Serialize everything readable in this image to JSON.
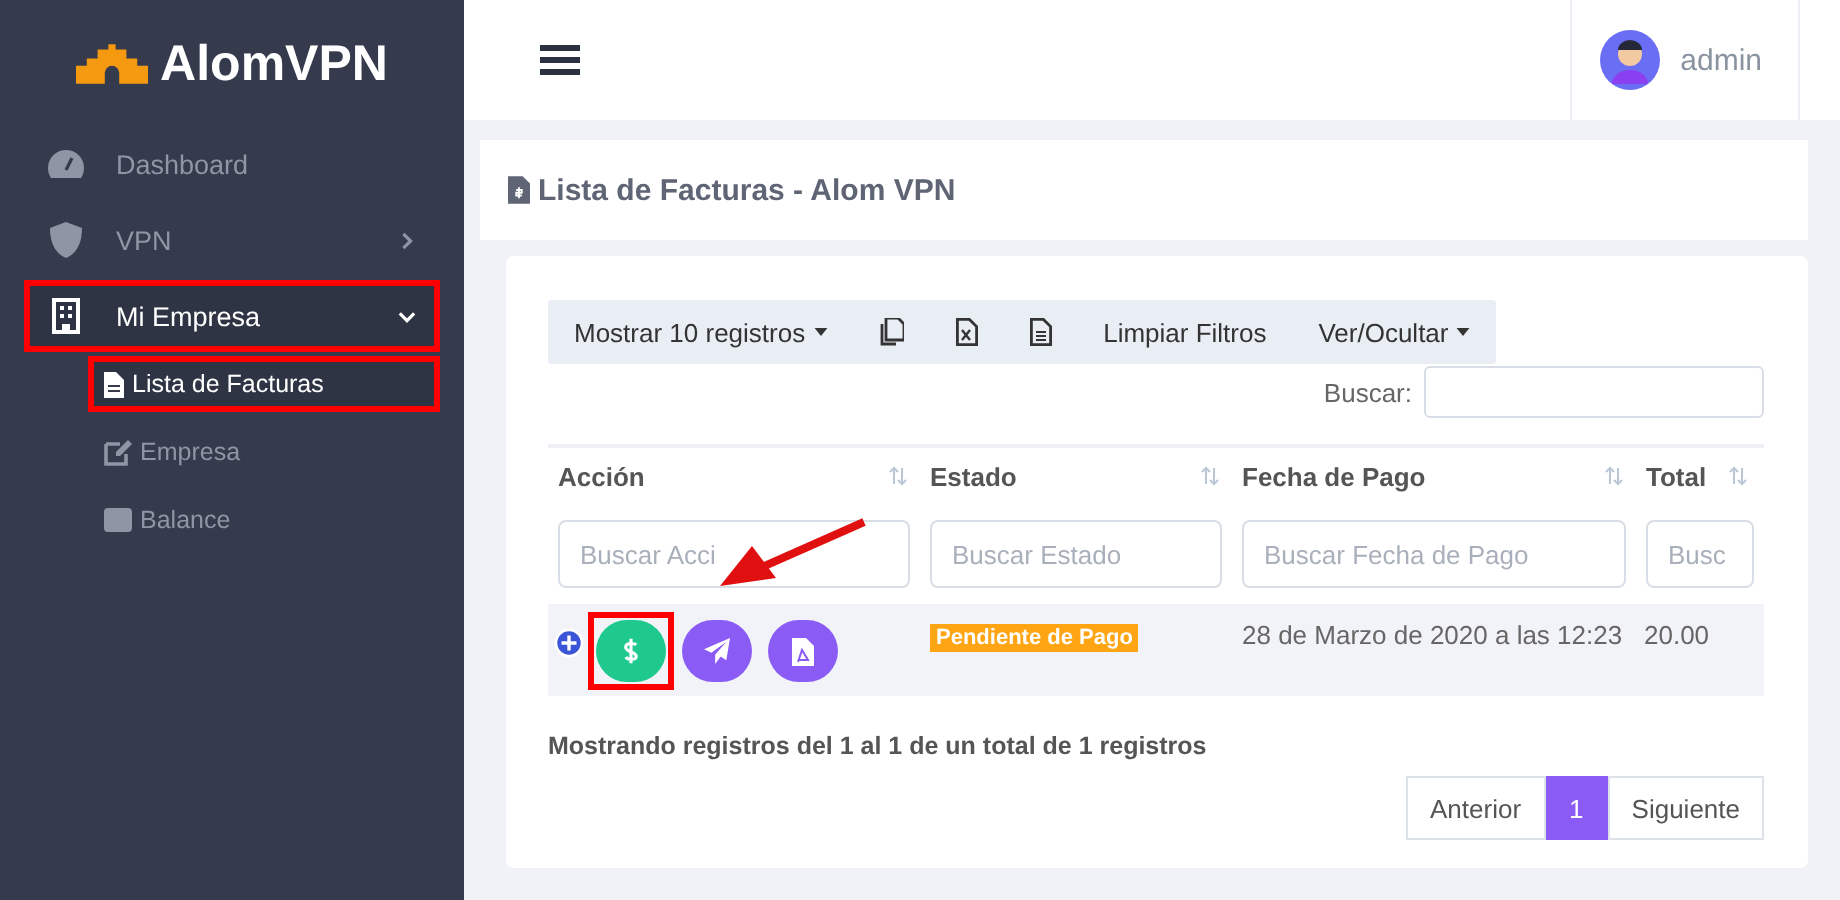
{
  "brand": "AlomVPN",
  "sidebar": {
    "items": [
      {
        "kind": "link",
        "label": "Dashboard",
        "highlighted": false
      },
      {
        "kind": "group",
        "label": "VPN",
        "expanded": false,
        "highlighted": false
      },
      {
        "kind": "group",
        "label": "Mi Empresa",
        "expanded": true,
        "highlighted": true,
        "children": [
          {
            "label": "Lista de Facturas",
            "selected": true,
            "highlighted": true
          },
          {
            "label": "Empresa",
            "selected": false,
            "highlighted": false
          },
          {
            "label": "Balance",
            "selected": false,
            "highlighted": false
          }
        ]
      }
    ]
  },
  "header": {
    "user": "admin"
  },
  "page_title": "Lista de Facturas - Alom VPN",
  "toolbar": [
    {
      "kind": "dropdown",
      "label": "Mostrar 10 registros"
    },
    {
      "kind": "icon"
    },
    {
      "kind": "icon"
    },
    {
      "kind": "icon"
    },
    {
      "kind": "text",
      "label": "Limpiar Filtros"
    },
    {
      "kind": "dropdown",
      "label": "Ver/Ocultar"
    }
  ],
  "search": {
    "label": "Buscar:"
  },
  "table": {
    "columns": [
      {
        "label": "Acción",
        "placeholder": "Buscar Acci"
      },
      {
        "label": "Estado",
        "placeholder": "Buscar Estado"
      },
      {
        "label": "Fecha de Pago",
        "placeholder": "Buscar Fecha de Pago"
      },
      {
        "label": "Total",
        "placeholder": "Busc"
      }
    ],
    "rows": [
      {
        "actions": [
          {
            "kind": "pay",
            "color": "#1fc98e",
            "highlighted": true
          },
          {
            "kind": "send",
            "color": "#8a5cf5",
            "highlighted": false
          },
          {
            "kind": "pdf",
            "color": "#8a5cf5",
            "highlighted": false
          }
        ],
        "status": "Pendiente de Pago",
        "date": "28 de Marzo de 2020 a las 12:23",
        "total": "20.00"
      }
    ]
  },
  "info": "Mostrando registros del 1 al 1 de un total de 1 registros",
  "pagination": [
    {
      "label": "Anterior",
      "selected": false
    },
    {
      "label": "1",
      "selected": true
    },
    {
      "label": "Siguiente",
      "selected": false
    }
  ],
  "annotation_arrow": true
}
